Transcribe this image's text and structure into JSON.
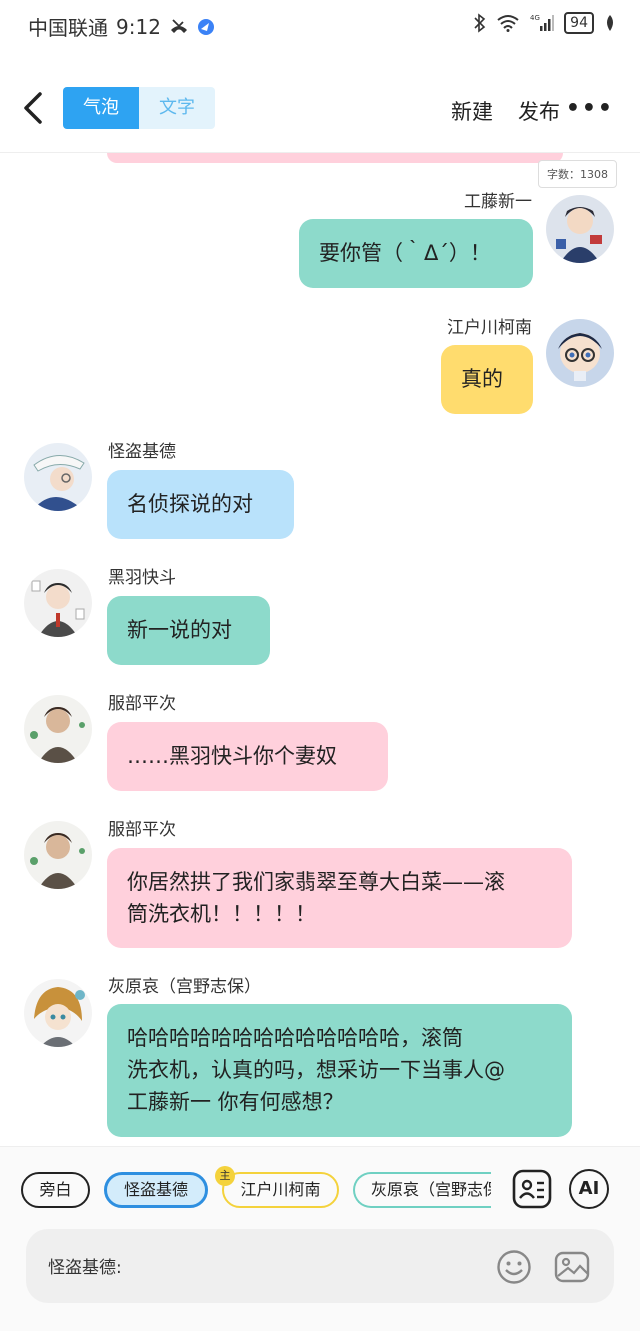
{
  "status": {
    "carrier": "中国联通",
    "time": "9:12",
    "battery": "94"
  },
  "topbar": {
    "tab_bubble": "气泡",
    "tab_text": "文字",
    "new_label": "新建",
    "publish_label": "发布",
    "more_label": "•••"
  },
  "chat": {
    "word_count": "字数：1308",
    "messages": [
      {
        "name": "工藤新一",
        "text": "要你管（｀Δ´）！"
      },
      {
        "name": "江户川柯南",
        "text": "真的"
      },
      {
        "name": "怪盗基德",
        "text": "名侦探说的对"
      },
      {
        "name": "黑羽快斗",
        "text": "新一说的对"
      },
      {
        "name": "服部平次",
        "text": "……黑羽快斗你个妻奴"
      },
      {
        "name": "服部平次",
        "text_line1": "你居然拱了我们家翡翠至尊大白菜——滚",
        "text_line2": "筒洗衣机！！！！！"
      },
      {
        "name": "灰原哀（宫野志保）",
        "text_line1": "哈哈哈哈哈哈哈哈哈哈哈哈哈，滚筒",
        "text_line2": "洗衣机，认真的吗，想采访一下当事人@",
        "text_line3": "工藤新一 你有何感想？"
      }
    ]
  },
  "roles": {
    "narration": "旁白",
    "kid": "怪盗基德",
    "conan": "江户川柯南",
    "haibara": "灰原哀（宫野志保）",
    "main_badge": "主"
  },
  "composer": {
    "speaker": "怪盗基德:",
    "ai_label": "AI"
  },
  "colors": {
    "accent": "#2ea3f2",
    "teal_bubble": "#8ddacb",
    "yellow_bubble": "#ffdc6e",
    "blue_bubble": "#b9e2fb",
    "pink_bubble": "#ffd0dc"
  }
}
